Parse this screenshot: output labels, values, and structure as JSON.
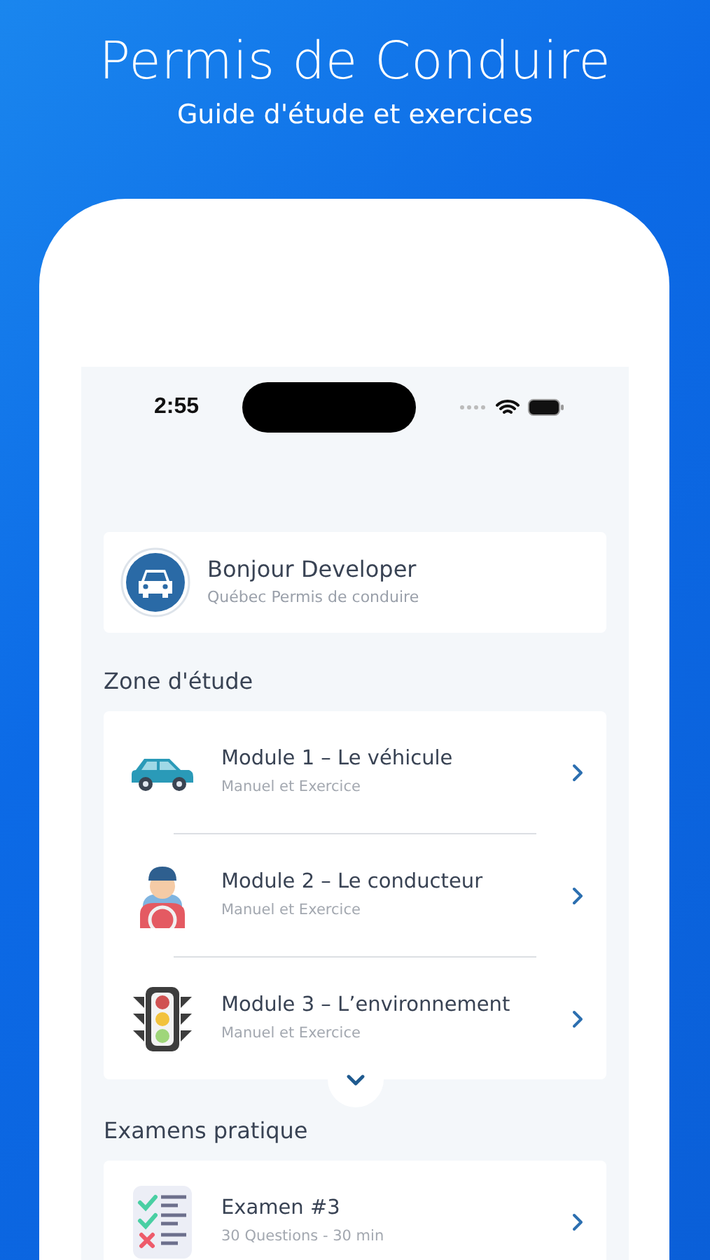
{
  "banner": {
    "title": "Permis de Conduire",
    "subtitle": "Guide d'étude et exercices"
  },
  "status_bar": {
    "time": "2:55"
  },
  "greeting": {
    "title": "Bonjour Developer",
    "subtitle": "Québec Permis de conduire"
  },
  "study_section": {
    "title": "Zone d'étude",
    "modules": [
      {
        "title": "Module 1 – Le véhicule",
        "subtitle": "Manuel et Exercice"
      },
      {
        "title": "Module 2 – Le conducteur",
        "subtitle": "Manuel et Exercice"
      },
      {
        "title": "Module 3 – L’environnement",
        "subtitle": "Manuel et Exercice"
      }
    ]
  },
  "exams_section": {
    "title": "Examens pratique",
    "exams": [
      {
        "title": "Examen #3",
        "subtitle": "30 Questions - 30 min"
      }
    ]
  }
}
